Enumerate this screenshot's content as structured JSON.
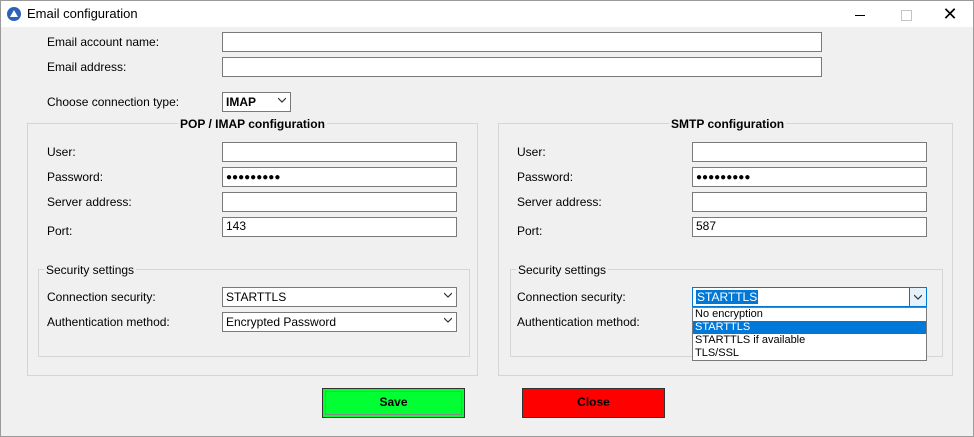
{
  "window": {
    "title": "Email configuration",
    "icons": {
      "app": "app-logo-icon",
      "minimize": "minimize-icon",
      "maximize": "maximize-icon",
      "close": "close-icon"
    },
    "close_glyph": "✕"
  },
  "account": {
    "name_label": "Email account name:",
    "name_value": "",
    "address_label": "Email address:",
    "address_value": ""
  },
  "connection_type": {
    "label": "Choose connection type:",
    "value": "IMAP"
  },
  "pop_imap": {
    "title": "POP / IMAP configuration",
    "user_label": "User:",
    "user_value": "",
    "password_label": "Password:",
    "password_value": "●●●●●●●●●",
    "server_label": "Server address:",
    "server_value": "",
    "port_label": "Port:",
    "port_value": "143",
    "security": {
      "title": "Security settings",
      "conn_label": "Connection security:",
      "conn_value": "STARTTLS",
      "auth_label": "Authentication method:",
      "auth_value": "Encrypted Password"
    }
  },
  "smtp": {
    "title": "SMTP configuration",
    "user_label": "User:",
    "user_value": "",
    "password_label": "Password:",
    "password_value": "●●●●●●●●●",
    "server_label": "Server address:",
    "server_value": "",
    "port_label": "Port:",
    "port_value": "587",
    "security": {
      "title": "Security settings",
      "conn_label": "Connection security:",
      "conn_value": "STARTTLS",
      "auth_label": "Authentication method:",
      "options": [
        "No encryption",
        "STARTTLS",
        "STARTTLS if available",
        "TLS/SSL"
      ],
      "selected_index": 1
    }
  },
  "buttons": {
    "save_label": "Save",
    "close_label": "Close"
  },
  "colors": {
    "save_bg": "#00ff33",
    "close_bg": "#ff0000",
    "selection": "#0078d7"
  }
}
